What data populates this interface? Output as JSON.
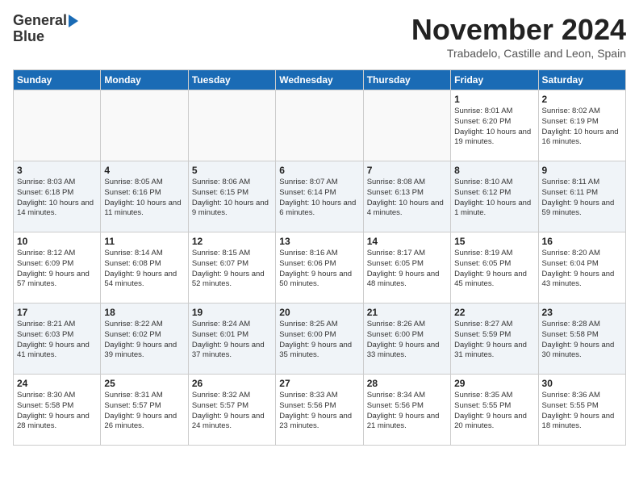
{
  "header": {
    "logo_line1": "General",
    "logo_line2": "Blue",
    "month_title": "November 2024",
    "location": "Trabadelo, Castille and Leon, Spain"
  },
  "weekdays": [
    "Sunday",
    "Monday",
    "Tuesday",
    "Wednesday",
    "Thursday",
    "Friday",
    "Saturday"
  ],
  "weeks": [
    [
      {
        "day": "",
        "info": ""
      },
      {
        "day": "",
        "info": ""
      },
      {
        "day": "",
        "info": ""
      },
      {
        "day": "",
        "info": ""
      },
      {
        "day": "",
        "info": ""
      },
      {
        "day": "1",
        "info": "Sunrise: 8:01 AM\nSunset: 6:20 PM\nDaylight: 10 hours and 19 minutes."
      },
      {
        "day": "2",
        "info": "Sunrise: 8:02 AM\nSunset: 6:19 PM\nDaylight: 10 hours and 16 minutes."
      }
    ],
    [
      {
        "day": "3",
        "info": "Sunrise: 8:03 AM\nSunset: 6:18 PM\nDaylight: 10 hours and 14 minutes."
      },
      {
        "day": "4",
        "info": "Sunrise: 8:05 AM\nSunset: 6:16 PM\nDaylight: 10 hours and 11 minutes."
      },
      {
        "day": "5",
        "info": "Sunrise: 8:06 AM\nSunset: 6:15 PM\nDaylight: 10 hours and 9 minutes."
      },
      {
        "day": "6",
        "info": "Sunrise: 8:07 AM\nSunset: 6:14 PM\nDaylight: 10 hours and 6 minutes."
      },
      {
        "day": "7",
        "info": "Sunrise: 8:08 AM\nSunset: 6:13 PM\nDaylight: 10 hours and 4 minutes."
      },
      {
        "day": "8",
        "info": "Sunrise: 8:10 AM\nSunset: 6:12 PM\nDaylight: 10 hours and 1 minute."
      },
      {
        "day": "9",
        "info": "Sunrise: 8:11 AM\nSunset: 6:11 PM\nDaylight: 9 hours and 59 minutes."
      }
    ],
    [
      {
        "day": "10",
        "info": "Sunrise: 8:12 AM\nSunset: 6:09 PM\nDaylight: 9 hours and 57 minutes."
      },
      {
        "day": "11",
        "info": "Sunrise: 8:14 AM\nSunset: 6:08 PM\nDaylight: 9 hours and 54 minutes."
      },
      {
        "day": "12",
        "info": "Sunrise: 8:15 AM\nSunset: 6:07 PM\nDaylight: 9 hours and 52 minutes."
      },
      {
        "day": "13",
        "info": "Sunrise: 8:16 AM\nSunset: 6:06 PM\nDaylight: 9 hours and 50 minutes."
      },
      {
        "day": "14",
        "info": "Sunrise: 8:17 AM\nSunset: 6:05 PM\nDaylight: 9 hours and 48 minutes."
      },
      {
        "day": "15",
        "info": "Sunrise: 8:19 AM\nSunset: 6:05 PM\nDaylight: 9 hours and 45 minutes."
      },
      {
        "day": "16",
        "info": "Sunrise: 8:20 AM\nSunset: 6:04 PM\nDaylight: 9 hours and 43 minutes."
      }
    ],
    [
      {
        "day": "17",
        "info": "Sunrise: 8:21 AM\nSunset: 6:03 PM\nDaylight: 9 hours and 41 minutes."
      },
      {
        "day": "18",
        "info": "Sunrise: 8:22 AM\nSunset: 6:02 PM\nDaylight: 9 hours and 39 minutes."
      },
      {
        "day": "19",
        "info": "Sunrise: 8:24 AM\nSunset: 6:01 PM\nDaylight: 9 hours and 37 minutes."
      },
      {
        "day": "20",
        "info": "Sunrise: 8:25 AM\nSunset: 6:00 PM\nDaylight: 9 hours and 35 minutes."
      },
      {
        "day": "21",
        "info": "Sunrise: 8:26 AM\nSunset: 6:00 PM\nDaylight: 9 hours and 33 minutes."
      },
      {
        "day": "22",
        "info": "Sunrise: 8:27 AM\nSunset: 5:59 PM\nDaylight: 9 hours and 31 minutes."
      },
      {
        "day": "23",
        "info": "Sunrise: 8:28 AM\nSunset: 5:58 PM\nDaylight: 9 hours and 30 minutes."
      }
    ],
    [
      {
        "day": "24",
        "info": "Sunrise: 8:30 AM\nSunset: 5:58 PM\nDaylight: 9 hours and 28 minutes."
      },
      {
        "day": "25",
        "info": "Sunrise: 8:31 AM\nSunset: 5:57 PM\nDaylight: 9 hours and 26 minutes."
      },
      {
        "day": "26",
        "info": "Sunrise: 8:32 AM\nSunset: 5:57 PM\nDaylight: 9 hours and 24 minutes."
      },
      {
        "day": "27",
        "info": "Sunrise: 8:33 AM\nSunset: 5:56 PM\nDaylight: 9 hours and 23 minutes."
      },
      {
        "day": "28",
        "info": "Sunrise: 8:34 AM\nSunset: 5:56 PM\nDaylight: 9 hours and 21 minutes."
      },
      {
        "day": "29",
        "info": "Sunrise: 8:35 AM\nSunset: 5:55 PM\nDaylight: 9 hours and 20 minutes."
      },
      {
        "day": "30",
        "info": "Sunrise: 8:36 AM\nSunset: 5:55 PM\nDaylight: 9 hours and 18 minutes."
      }
    ]
  ]
}
